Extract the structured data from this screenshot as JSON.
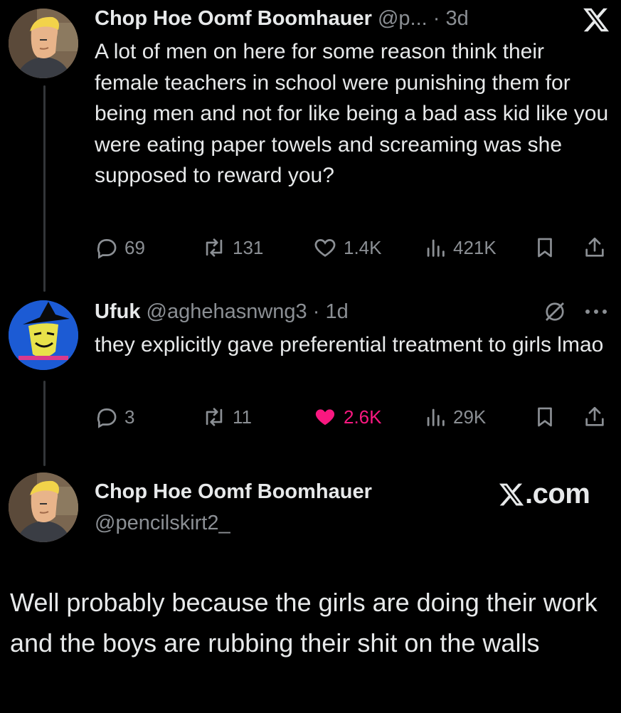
{
  "tweet1": {
    "name": "Chop Hoe Oomf Boomhauer",
    "handle": "@p...",
    "dot": "·",
    "time": "3d",
    "text": "A lot of men on here for some reason think their female teachers in school were punishing them for being men and not for like being a bad ass kid like you were eating paper towels and screaming was she supposed to reward you?",
    "replies": "69",
    "reposts": "131",
    "likes": "1.4K",
    "views": "421K"
  },
  "tweet2": {
    "name": "Ufuk",
    "handle": "@aghehasnwng3",
    "dot": "·",
    "time": "1d",
    "text": "they explicitly gave preferential treatment to girls lmao",
    "replies": "3",
    "reposts": "11",
    "likes": "2.6K",
    "views": "29K"
  },
  "quote": {
    "name": "Chop Hoe Oomf Boomhauer",
    "handle": "@pencilskirt2_",
    "site": ".com",
    "text": "Well probably because the girls are doing their work and the boys are rubbing their shit on the walls"
  },
  "icons": {
    "reply": "reply-icon",
    "repost": "repost-icon",
    "like": "heart-icon",
    "views": "views-icon",
    "bookmark": "bookmark-icon",
    "share": "share-icon",
    "x_logo": "x-logo-icon",
    "grok": "grok-icon",
    "more": "more-icon"
  },
  "colors": {
    "background": "#000000",
    "text": "#e7e9ea",
    "secondary": "#8b8f94",
    "like_active": "#f91880"
  }
}
